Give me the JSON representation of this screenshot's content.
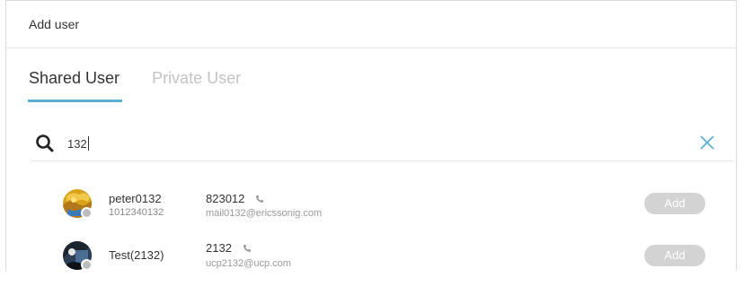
{
  "dialog": {
    "title": "Add user"
  },
  "tabs": [
    {
      "label": "Shared User",
      "active": true
    },
    {
      "label": "Private User",
      "active": false
    }
  ],
  "search": {
    "value": "132",
    "icon": "search-icon",
    "clear_icon": "close-icon"
  },
  "users": [
    {
      "name": "peter0132",
      "id": "1012340132",
      "phone": "823012",
      "email": "mail0132@ericssonig.com",
      "add_label": "Add",
      "status": "offline"
    },
    {
      "name": "Test(2132)",
      "id": "",
      "phone": "2132",
      "email": "ucp2132@ucp.com",
      "add_label": "Add",
      "status": "offline"
    }
  ],
  "colors": {
    "accent": "#5bafd6",
    "add_button": "#d3d3d3",
    "inactive_tab": "#c4c4c4"
  }
}
